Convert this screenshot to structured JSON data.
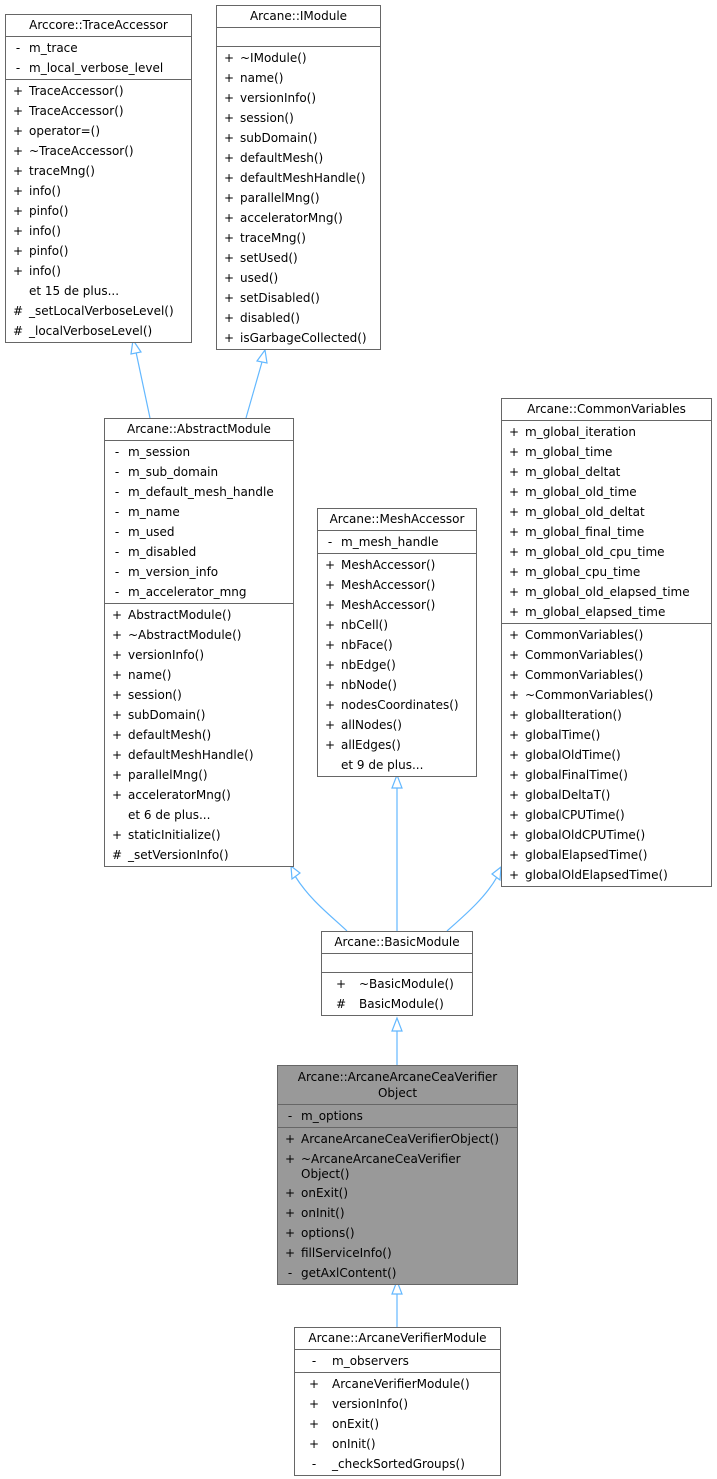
{
  "diagram": {
    "type": "uml-class-inheritance",
    "edge_color": "#63b8ff",
    "classes": {
      "trace_accessor": {
        "name": "Arccore::TraceAccessor",
        "attributes": [
          {
            "vis": "-",
            "name": "m_trace"
          },
          {
            "vis": "-",
            "name": "m_local_verbose_level"
          }
        ],
        "methods": [
          {
            "vis": "+",
            "name": "TraceAccessor()"
          },
          {
            "vis": "+",
            "name": "TraceAccessor()"
          },
          {
            "vis": "+",
            "name": "operator=()"
          },
          {
            "vis": "+",
            "name": "~TraceAccessor()"
          },
          {
            "vis": "+",
            "name": "traceMng()"
          },
          {
            "vis": "+",
            "name": "info()"
          },
          {
            "vis": "+",
            "name": "pinfo()"
          },
          {
            "vis": "+",
            "name": "info()"
          },
          {
            "vis": "+",
            "name": "pinfo()"
          },
          {
            "vis": "+",
            "name": "info()"
          },
          {
            "vis": "",
            "name": "et 15 de plus..."
          },
          {
            "vis": "#",
            "name": "_setLocalVerboseLevel()"
          },
          {
            "vis": "#",
            "name": "_localVerboseLevel()"
          }
        ]
      },
      "imodule": {
        "name": "Arcane::IModule",
        "attributes": [],
        "methods": [
          {
            "vis": "+",
            "name": "~IModule()"
          },
          {
            "vis": "+",
            "name": "name()"
          },
          {
            "vis": "+",
            "name": "versionInfo()"
          },
          {
            "vis": "+",
            "name": "session()"
          },
          {
            "vis": "+",
            "name": "subDomain()"
          },
          {
            "vis": "+",
            "name": "defaultMesh()"
          },
          {
            "vis": "+",
            "name": "defaultMeshHandle()"
          },
          {
            "vis": "+",
            "name": "parallelMng()"
          },
          {
            "vis": "+",
            "name": "acceleratorMng()"
          },
          {
            "vis": "+",
            "name": "traceMng()"
          },
          {
            "vis": "+",
            "name": "setUsed()"
          },
          {
            "vis": "+",
            "name": "used()"
          },
          {
            "vis": "+",
            "name": "setDisabled()"
          },
          {
            "vis": "+",
            "name": "disabled()"
          },
          {
            "vis": "+",
            "name": "isGarbageCollected()"
          }
        ]
      },
      "abstract_module": {
        "name": "Arcane::AbstractModule",
        "attributes": [
          {
            "vis": "-",
            "name": "m_session"
          },
          {
            "vis": "-",
            "name": "m_sub_domain"
          },
          {
            "vis": "-",
            "name": "m_default_mesh_handle"
          },
          {
            "vis": "-",
            "name": "m_name"
          },
          {
            "vis": "-",
            "name": "m_used"
          },
          {
            "vis": "-",
            "name": "m_disabled"
          },
          {
            "vis": "-",
            "name": "m_version_info"
          },
          {
            "vis": "-",
            "name": "m_accelerator_mng"
          }
        ],
        "methods": [
          {
            "vis": "+",
            "name": "AbstractModule()"
          },
          {
            "vis": "+",
            "name": "~AbstractModule()"
          },
          {
            "vis": "+",
            "name": "versionInfo()"
          },
          {
            "vis": "+",
            "name": "name()"
          },
          {
            "vis": "+",
            "name": "session()"
          },
          {
            "vis": "+",
            "name": "subDomain()"
          },
          {
            "vis": "+",
            "name": "defaultMesh()"
          },
          {
            "vis": "+",
            "name": "defaultMeshHandle()"
          },
          {
            "vis": "+",
            "name": "parallelMng()"
          },
          {
            "vis": "+",
            "name": "acceleratorMng()"
          },
          {
            "vis": "",
            "name": "et 6 de plus..."
          },
          {
            "vis": "+",
            "name": "staticInitialize()"
          },
          {
            "vis": "#",
            "name": "_setVersionInfo()"
          }
        ]
      },
      "mesh_accessor": {
        "name": "Arcane::MeshAccessor",
        "attributes": [
          {
            "vis": "-",
            "name": "m_mesh_handle"
          }
        ],
        "methods": [
          {
            "vis": "+",
            "name": "MeshAccessor()"
          },
          {
            "vis": "+",
            "name": "MeshAccessor()"
          },
          {
            "vis": "+",
            "name": "MeshAccessor()"
          },
          {
            "vis": "+",
            "name": "nbCell()"
          },
          {
            "vis": "+",
            "name": "nbFace()"
          },
          {
            "vis": "+",
            "name": "nbEdge()"
          },
          {
            "vis": "+",
            "name": "nbNode()"
          },
          {
            "vis": "+",
            "name": "nodesCoordinates()"
          },
          {
            "vis": "+",
            "name": "allNodes()"
          },
          {
            "vis": "+",
            "name": "allEdges()"
          },
          {
            "vis": "",
            "name": "et 9 de plus..."
          }
        ]
      },
      "common_variables": {
        "name": "Arcane::CommonVariables",
        "attributes": [
          {
            "vis": "+",
            "name": "m_global_iteration"
          },
          {
            "vis": "+",
            "name": "m_global_time"
          },
          {
            "vis": "+",
            "name": "m_global_deltat"
          },
          {
            "vis": "+",
            "name": "m_global_old_time"
          },
          {
            "vis": "+",
            "name": "m_global_old_deltat"
          },
          {
            "vis": "+",
            "name": "m_global_final_time"
          },
          {
            "vis": "+",
            "name": "m_global_old_cpu_time"
          },
          {
            "vis": "+",
            "name": "m_global_cpu_time"
          },
          {
            "vis": "+",
            "name": "m_global_old_elapsed_time"
          },
          {
            "vis": "+",
            "name": "m_global_elapsed_time"
          }
        ],
        "methods": [
          {
            "vis": "+",
            "name": "CommonVariables()"
          },
          {
            "vis": "+",
            "name": "CommonVariables()"
          },
          {
            "vis": "+",
            "name": "CommonVariables()"
          },
          {
            "vis": "+",
            "name": "~CommonVariables()"
          },
          {
            "vis": "+",
            "name": "globalIteration()"
          },
          {
            "vis": "+",
            "name": "globalTime()"
          },
          {
            "vis": "+",
            "name": "globalOldTime()"
          },
          {
            "vis": "+",
            "name": "globalFinalTime()"
          },
          {
            "vis": "+",
            "name": "globalDeltaT()"
          },
          {
            "vis": "+",
            "name": "globalCPUTime()"
          },
          {
            "vis": "+",
            "name": "globalOldCPUTime()"
          },
          {
            "vis": "+",
            "name": "globalElapsedTime()"
          },
          {
            "vis": "+",
            "name": "globalOldElapsedTime()"
          }
        ]
      },
      "basic_module": {
        "name": "Arcane::BasicModule",
        "attributes": [],
        "methods": [
          {
            "vis": "+",
            "name": "~BasicModule()"
          },
          {
            "vis": "#",
            "name": "BasicModule()"
          }
        ]
      },
      "verifier_object": {
        "name": "Arcane::ArcaneArcaneCeaVerifier Object",
        "highlighted": true,
        "attributes": [
          {
            "vis": "-",
            "name": "m_options"
          }
        ],
        "methods": [
          {
            "vis": "+",
            "name": "ArcaneArcaneCeaVerifierObject()"
          },
          {
            "vis": "+",
            "name": "~ArcaneArcaneCeaVerifier Object()"
          },
          {
            "vis": "+",
            "name": "onExit()"
          },
          {
            "vis": "+",
            "name": "onInit()"
          },
          {
            "vis": "+",
            "name": "options()"
          },
          {
            "vis": "+",
            "name": "fillServiceInfo()"
          },
          {
            "vis": "-",
            "name": "getAxlContent()"
          }
        ]
      },
      "verifier_module": {
        "name": "Arcane::ArcaneVerifierModule",
        "attributes": [
          {
            "vis": "-",
            "name": "m_observers"
          }
        ],
        "methods": [
          {
            "vis": "+",
            "name": "ArcaneVerifierModule()"
          },
          {
            "vis": "+",
            "name": "versionInfo()"
          },
          {
            "vis": "+",
            "name": "onExit()"
          },
          {
            "vis": "+",
            "name": "onInit()"
          },
          {
            "vis": "-",
            "name": "_checkSortedGroups()"
          }
        ]
      }
    },
    "inheritance": [
      {
        "child": "Arcane::AbstractModule",
        "parent": "Arccore::TraceAccessor"
      },
      {
        "child": "Arcane::AbstractModule",
        "parent": "Arcane::IModule"
      },
      {
        "child": "Arcane::BasicModule",
        "parent": "Arcane::AbstractModule"
      },
      {
        "child": "Arcane::BasicModule",
        "parent": "Arcane::MeshAccessor"
      },
      {
        "child": "Arcane::BasicModule",
        "parent": "Arcane::CommonVariables"
      },
      {
        "child": "Arcane::ArcaneArcaneCeaVerifier Object",
        "parent": "Arcane::BasicModule"
      },
      {
        "child": "Arcane::ArcaneVerifierModule",
        "parent": "Arcane::ArcaneArcaneCeaVerifier Object"
      }
    ]
  }
}
